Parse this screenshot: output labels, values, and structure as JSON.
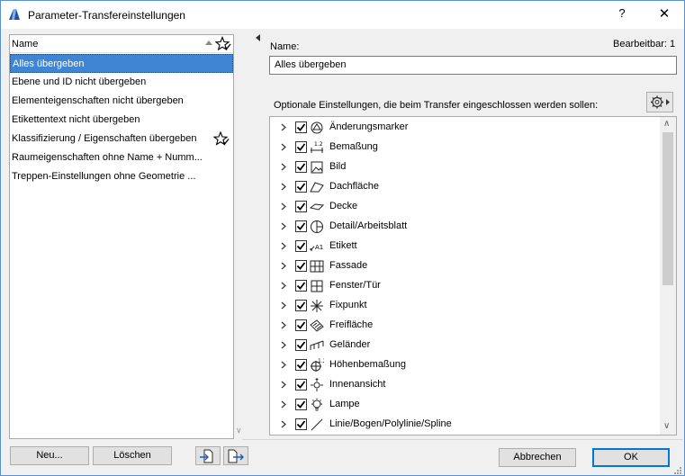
{
  "window": {
    "title": "Parameter-Transfereinstellungen",
    "help_label": "?",
    "close_label": "✕"
  },
  "list": {
    "header": "Name",
    "items": [
      {
        "label": "Alles übergeben",
        "selected": true,
        "favorite": false
      },
      {
        "label": "Ebene und ID nicht übergeben",
        "selected": false,
        "favorite": false
      },
      {
        "label": "Elementeigenschaften nicht übergeben",
        "selected": false,
        "favorite": false
      },
      {
        "label": "Etikettentext nicht übergeben",
        "selected": false,
        "favorite": false
      },
      {
        "label": "Klassifizierung / Eigenschaften übergeben",
        "selected": false,
        "favorite": true
      },
      {
        "label": "Raumeigenschaften ohne Name + Numm...",
        "selected": false,
        "favorite": false
      },
      {
        "label": "Treppen-Einstellungen ohne Geometrie ...",
        "selected": false,
        "favorite": false
      }
    ]
  },
  "buttons": {
    "new": "Neu...",
    "delete": "Löschen",
    "cancel": "Abbrechen",
    "ok": "OK"
  },
  "details": {
    "name_label": "Name:",
    "editable_label": "Bearbeitbar: 1",
    "name_value": "Alles übergeben",
    "optional_label": "Optionale Einstellungen, die beim Transfer eingeschlossen werden sollen:"
  },
  "tree": {
    "items": [
      {
        "label": "Änderungsmarker",
        "icon": "change-marker-icon",
        "checked": true
      },
      {
        "label": "Bemaßung",
        "icon": "dimension-icon",
        "checked": true
      },
      {
        "label": "Bild",
        "icon": "image-icon",
        "checked": true
      },
      {
        "label": "Dachfläche",
        "icon": "roof-icon",
        "checked": true
      },
      {
        "label": "Decke",
        "icon": "slab-icon",
        "checked": true
      },
      {
        "label": "Detail/Arbeitsblatt",
        "icon": "detail-icon",
        "checked": true
      },
      {
        "label": "Etikett",
        "icon": "label-icon",
        "checked": true
      },
      {
        "label": "Fassade",
        "icon": "curtain-wall-icon",
        "checked": true
      },
      {
        "label": "Fenster/Tür",
        "icon": "window-door-icon",
        "checked": true
      },
      {
        "label": "Fixpunkt",
        "icon": "hotspot-icon",
        "checked": true
      },
      {
        "label": "Freifläche",
        "icon": "fill-icon",
        "checked": true
      },
      {
        "label": "Geländer",
        "icon": "railing-icon",
        "checked": true
      },
      {
        "label": "Höhenbemaßung",
        "icon": "level-dimension-icon",
        "checked": true
      },
      {
        "label": "Innenansicht",
        "icon": "interior-elevation-icon",
        "checked": true
      },
      {
        "label": "Lampe",
        "icon": "lamp-icon",
        "checked": true
      },
      {
        "label": "Linie/Bogen/Polylinie/Spline",
        "icon": "line-icon",
        "checked": true
      }
    ]
  },
  "colors": {
    "selection": "#3f85d3",
    "window_border": "#5b8fd1",
    "ok_border": "#0078d7"
  }
}
